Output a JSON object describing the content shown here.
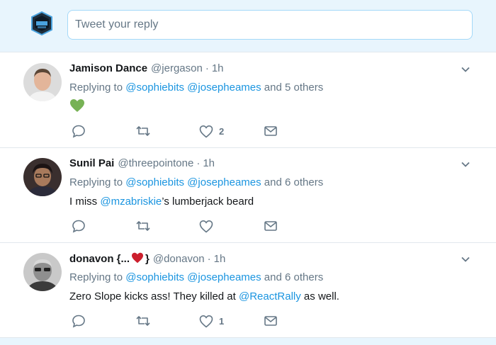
{
  "reply_box": {
    "placeholder": "Tweet your reply",
    "avatar_icon": "shield-logo-icon"
  },
  "tweets": [
    {
      "name": "Jamison Dance",
      "handle": "@jergason",
      "sep": "·",
      "time": "1h",
      "replying_prefix": "Replying to",
      "replying_mentions": [
        "@sophiebits",
        "@josepheames"
      ],
      "replying_suffix": "and 5 others",
      "body_emoji": "green-heart",
      "like_count": "2"
    },
    {
      "name": "Sunil Pai",
      "handle": "@threepointone",
      "sep": "·",
      "time": "1h",
      "replying_prefix": "Replying to",
      "replying_mentions": [
        "@sophiebits",
        "@josepheames"
      ],
      "replying_suffix": "and 6 others",
      "body_before": "I miss ",
      "body_mention": "@mzabriskie",
      "body_after": "’s lumberjack beard",
      "like_count": ""
    },
    {
      "name_before": "donavon {...",
      "name_after": "}",
      "handle": "@donavon",
      "sep": "·",
      "time": "1h",
      "replying_prefix": "Replying to",
      "replying_mentions": [
        "@sophiebits",
        "@josepheames"
      ],
      "replying_suffix": "and 6 others",
      "body_before": "Zero Slope kicks ass! They killed at ",
      "body_mention": "@ReactRally",
      "body_after": " as well.",
      "like_count": "1"
    }
  ],
  "colors": {
    "accent": "#1b95e0",
    "muted": "#657786",
    "reply_bg": "#e8f5fd",
    "heart_red": "#e0245e",
    "heart_green": "#77b255"
  }
}
